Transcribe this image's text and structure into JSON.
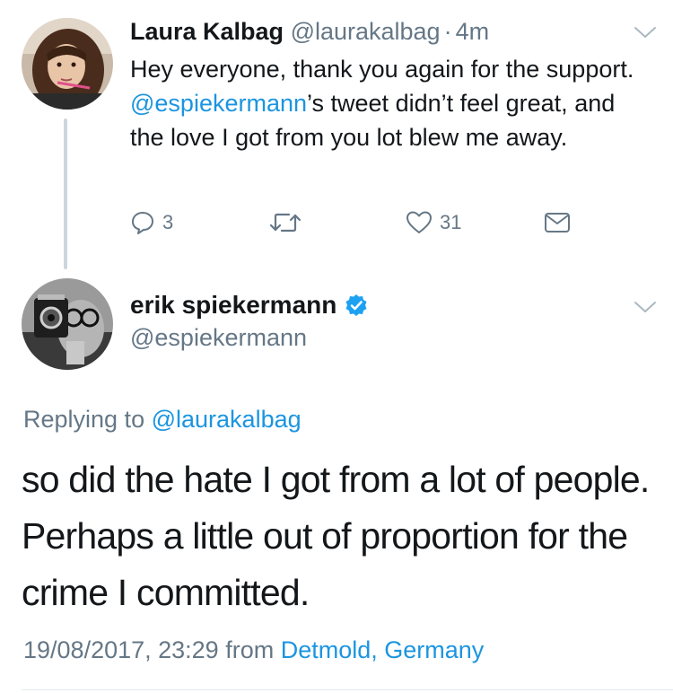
{
  "tweet1": {
    "author_name": "Laura Kalbag",
    "author_handle": "@laurakalbag",
    "separator": "·",
    "time": "4m",
    "text_parts": {
      "part1": "Hey everyone, thank you again for the support. ",
      "mention": "@espiekermann",
      "part2": "’s tweet didn’t feel great, and the love I got from you lot blew me away."
    },
    "actions": {
      "reply_count": "3",
      "retweet_count": "",
      "like_count": "31"
    }
  },
  "tweet2": {
    "author_name": "erik spiekermann",
    "verified": true,
    "author_handle": "@espiekermann",
    "replying_label": "Replying to",
    "replying_handle": "@laurakalbag",
    "text": "so did the hate I got from a lot of people. Perhaps a little out of proportion for the crime I committed.",
    "timestamp": "19/08/2017, 23:29",
    "from_label": "from",
    "location": "Detmold, Germany"
  },
  "colors": {
    "text": "#14171a",
    "secondary": "#657786",
    "link": "#1b95e0",
    "verified": "#1da1f2",
    "thread_line": "#ccd6dd"
  }
}
